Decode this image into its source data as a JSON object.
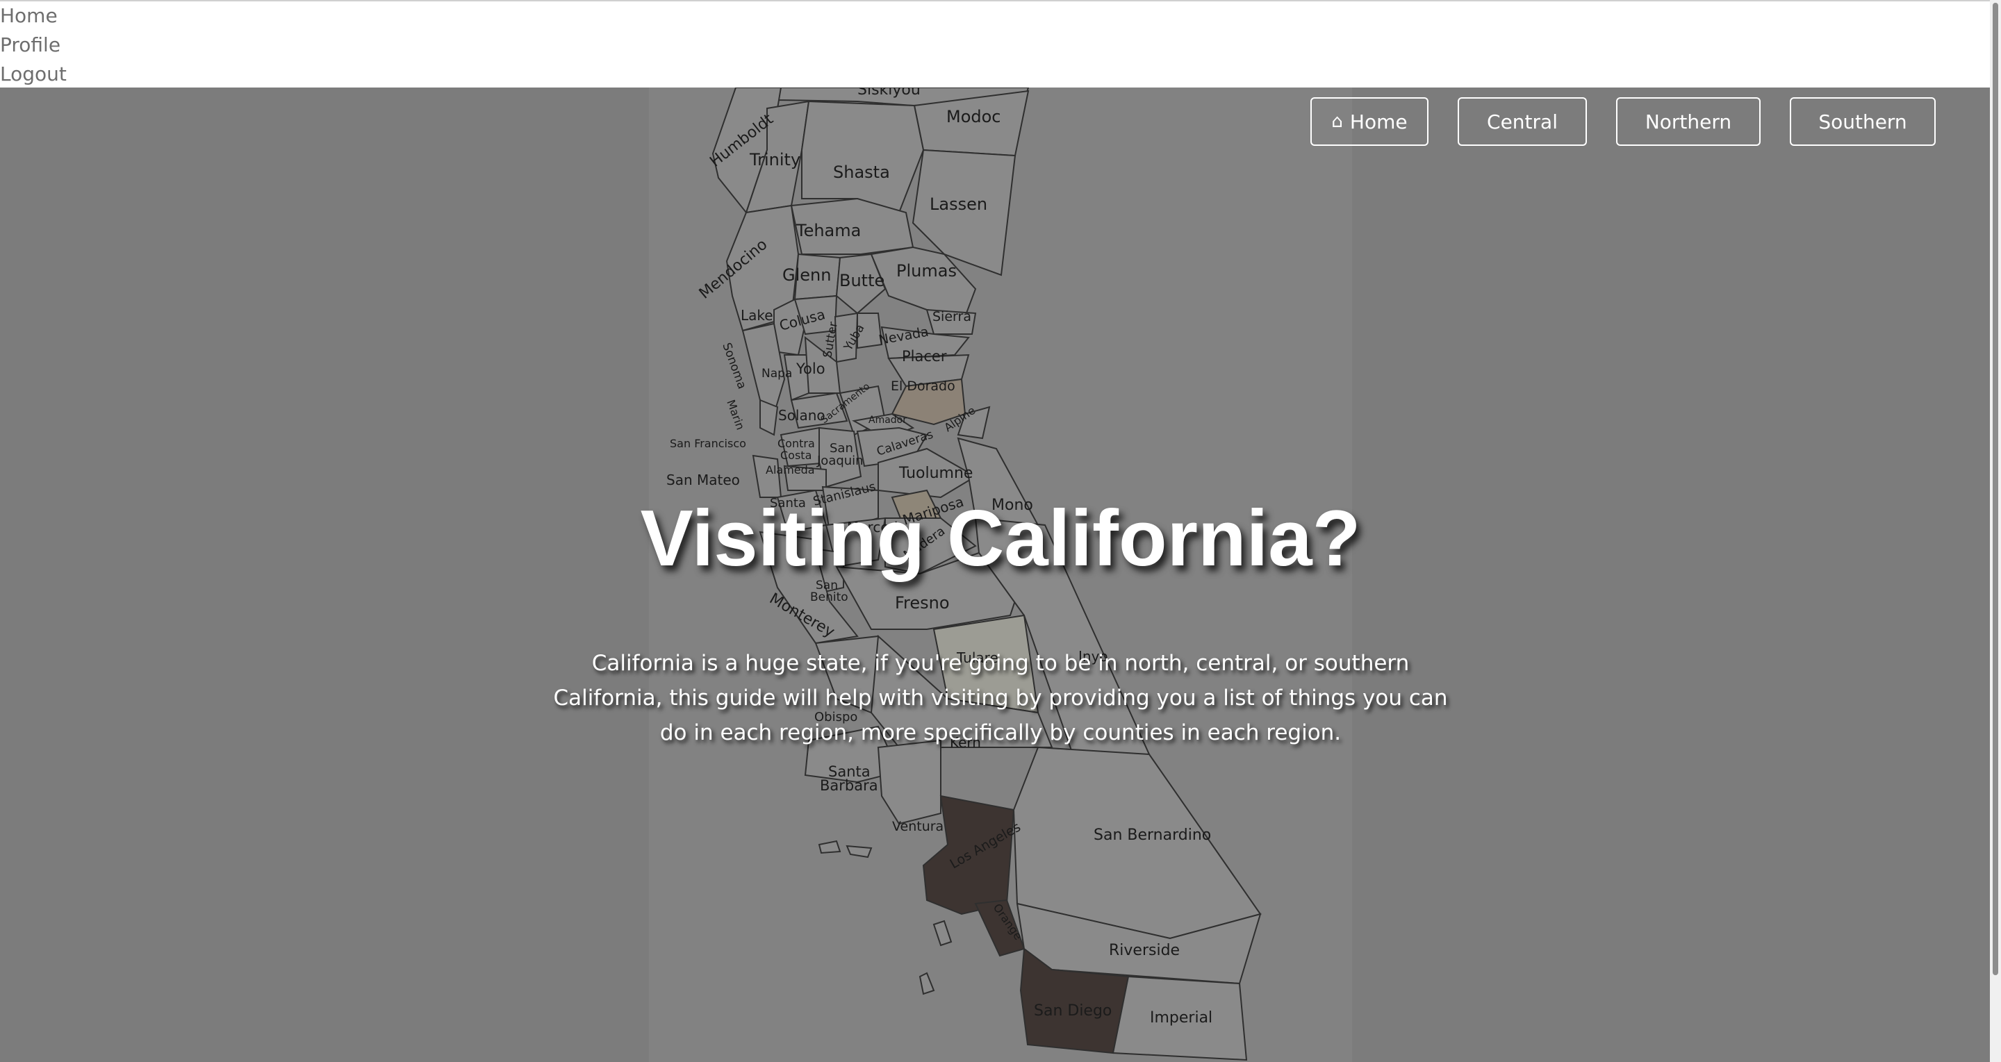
{
  "top_links": [
    "Home",
    "Profile",
    "Logout"
  ],
  "nav": {
    "home_label": "Home",
    "central_label": "Central",
    "northern_label": "Northern",
    "southern_label": "Southern"
  },
  "hero": {
    "title": "Visiting California?",
    "intro": "California is a huge state, if you're going to be in north, central, or southern California, this guide will help with visiting by providing you a list of things you can do in each region, more specifically by counties in each region."
  },
  "map": {
    "counties": {
      "siskiyou": "Siskiyou",
      "modoc": "Modoc",
      "humboldt": "Humboldt",
      "trinity": "Trinity",
      "shasta": "Shasta",
      "lassen": "Lassen",
      "tehama": "Tehama",
      "mendocino": "Mendocino",
      "glenn": "Glenn",
      "butte": "Butte",
      "plumas": "Plumas",
      "lake": "Lake",
      "colusa": "Colusa",
      "sierra": "Sierra",
      "sutter": "Sutter",
      "yuba": "Yuba",
      "nevada": "Nevada",
      "sonoma": "Sonoma",
      "placer": "Placer",
      "napa": "Napa",
      "yolo": "Yolo",
      "el_dorado": "El Dorado",
      "marin": "Marin",
      "solano": "Solano",
      "sacramento": "Sacramento",
      "amador": "Amador",
      "alpine": "Alpine",
      "san_francisco": "San Francisco",
      "contra_costa_1": "Contra",
      "contra_costa_2": "Costa",
      "san_joaquin_1": "San",
      "san_joaquin_2": "Joaquin",
      "calaveras": "Calaveras",
      "san_mateo": "San Mateo",
      "alameda": "Alameda",
      "tuolumne": "Tuolumne",
      "mono": "Mono",
      "santa_clara": "Santa",
      "stanislaus": "Stanislaus",
      "mariposa": "Mariposa",
      "merced": "Merced",
      "madera": "Madera",
      "san_benito_1": "San",
      "san_benito_2": "Benito",
      "fresno": "Fresno",
      "monterey": "Monterey",
      "tulare": "Tulare",
      "inyo": "Inyo",
      "slo_1": "Obispo",
      "kern": "Kern",
      "santa_barbara_1": "Santa",
      "santa_barbara_2": "Barbara",
      "ventura": "Ventura",
      "los_angeles": "Los Angeles",
      "san_bernardino": "San Bernardino",
      "orange": "Orange",
      "riverside": "Riverside",
      "san_diego": "San Diego",
      "imperial": "Imperial"
    },
    "colors": {
      "county_fill": "#8a8a8a",
      "county_border": "#2f2f2f",
      "el_dorado": "#8c8276",
      "mariposa": "#8e8678",
      "tulare": "#9c9c94",
      "highlight_south": "#3d3431",
      "overlay": "#7c7c7c"
    }
  }
}
